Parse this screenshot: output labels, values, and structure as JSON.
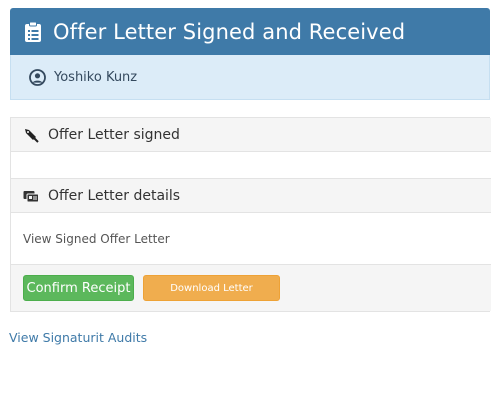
{
  "header": {
    "title": "Offer Letter Signed and Received",
    "icon": "clipboard-icon"
  },
  "user": {
    "name": "Yoshiko Kunz",
    "icon": "user-circle-icon"
  },
  "signed_section": {
    "label": "Offer Letter signed",
    "icon": "pen-nib-icon"
  },
  "details_section": {
    "label": "Offer Letter details",
    "icon": "id-card-icon",
    "link": "View Signed Offer Letter"
  },
  "actions": {
    "confirm_label": "Confirm Receipt",
    "download_label": "Download Letter"
  },
  "audits_link": "View Signaturit Audits",
  "colors": {
    "header_bg": "#3f7aa8",
    "user_bar_bg": "#dcecf8",
    "confirm_bg": "#5cb85c",
    "download_bg": "#f0ad4e",
    "link": "#3f7aa8"
  }
}
